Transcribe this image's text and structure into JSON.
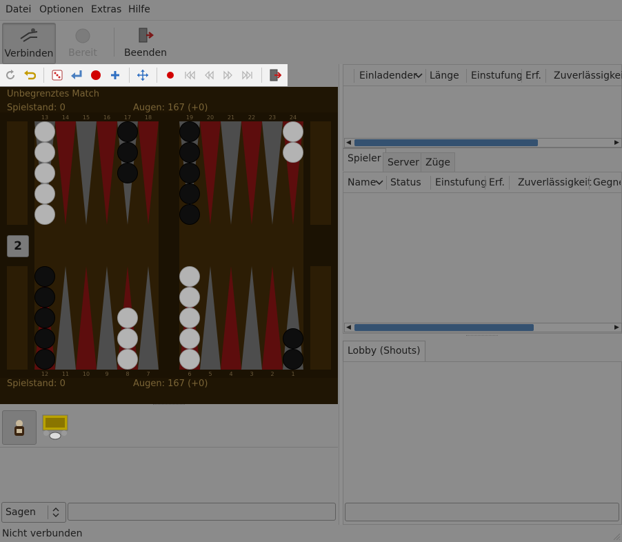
{
  "menu": [
    "Datei",
    "Optionen",
    "Extras",
    "Hilfe"
  ],
  "toolbar": {
    "connect_label": "Verbinden",
    "ready_label": "Bereit",
    "quit_label": "Beenden"
  },
  "icon_toolbar": [
    "refresh-icon",
    "undo-icon",
    "dice-icon",
    "resign-icon",
    "record-icon",
    "add-icon",
    "move-icon",
    "record-dot-icon",
    "first-icon",
    "prev-icon",
    "next-icon",
    "last-icon",
    "exit-icon"
  ],
  "board": {
    "match_title": "Unbegrenztes Match",
    "score_top": "Spielstand: 0",
    "pips_top": "Augen: 167 (+0)",
    "score_bottom": "Spielstand: 0",
    "pips_bottom": "Augen: 167 (+0)",
    "cube": "2",
    "top_points": [
      "13",
      "14",
      "15",
      "16",
      "17",
      "18",
      "19",
      "20",
      "21",
      "22",
      "23",
      "24"
    ],
    "bottom_points": [
      "12",
      "11",
      "10",
      "9",
      "8",
      "7",
      "6",
      "5",
      "4",
      "3",
      "2",
      "1"
    ],
    "colors": {
      "wood": "#2c1d05",
      "red": "#5d0d0d",
      "gray": "#4d4d4d",
      "white_checker": "#b3b3b3",
      "black_checker": "#0e0e0e"
    }
  },
  "invites": {
    "columns": [
      "Einladender",
      "Länge",
      "Einstufung",
      "Erf.",
      "Zuverlässigkeit"
    ]
  },
  "tabs": [
    "Spieler",
    "Server",
    "Züge"
  ],
  "players": {
    "columns": [
      "Name",
      "Status",
      "Einstufung",
      "Erf.",
      "Zuverlässigkeit",
      "Gegne"
    ]
  },
  "lobby_tab": "Lobby (Shouts)",
  "chat": {
    "mode": "Sagen",
    "input_value": ""
  },
  "status_text": "Nicht verbunden"
}
